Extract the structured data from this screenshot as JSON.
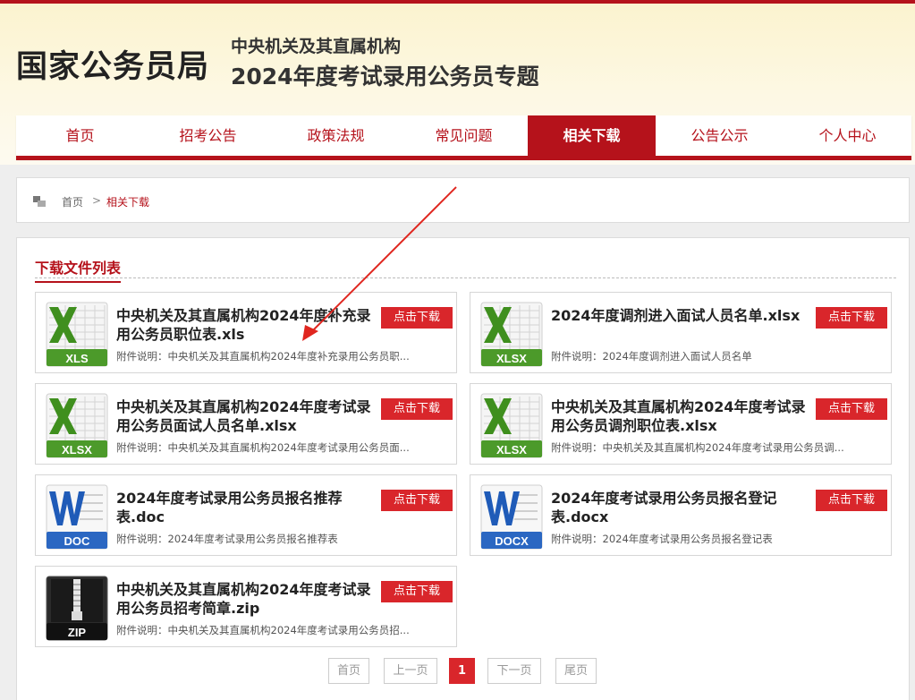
{
  "header": {
    "site_name": "国家公务员局",
    "subtitle1": "中央机关及其直属机构",
    "subtitle2": "2024年度考试录用公务员专题"
  },
  "nav": {
    "items": [
      {
        "label": "首页",
        "active": false
      },
      {
        "label": "招考公告",
        "active": false
      },
      {
        "label": "政策法规",
        "active": false
      },
      {
        "label": "常见问题",
        "active": false
      },
      {
        "label": "相关下载",
        "active": true
      },
      {
        "label": "公告公示",
        "active": false
      },
      {
        "label": "个人中心",
        "active": false
      }
    ]
  },
  "breadcrumb": {
    "home": "首页",
    "separator": ">",
    "current": "相关下载"
  },
  "section": {
    "title": "下载文件列表"
  },
  "files": [
    {
      "type": "xls",
      "ext_label": "XLS",
      "title": "中央机关及其直属机构2024年度补充录用公务员职位表.xls",
      "desc": "附件说明：中央机关及其直属机构2024年度补充录用公务员职...",
      "button": "点击下载"
    },
    {
      "type": "xls",
      "ext_label": "XLSX",
      "title": "2024年度调剂进入面试人员名单.xlsx",
      "desc": "附件说明：2024年度调剂进入面试人员名单",
      "button": "点击下载"
    },
    {
      "type": "xls",
      "ext_label": "XLSX",
      "title": "中央机关及其直属机构2024年度考试录用公务员面试人员名单.xlsx",
      "desc": "附件说明：中央机关及其直属机构2024年度考试录用公务员面...",
      "button": "点击下载"
    },
    {
      "type": "xls",
      "ext_label": "XLSX",
      "title": "中央机关及其直属机构2024年度考试录用公务员调剂职位表.xlsx",
      "desc": "附件说明：中央机关及其直属机构2024年度考试录用公务员调...",
      "button": "点击下载"
    },
    {
      "type": "doc",
      "ext_label": "DOC",
      "title": "2024年度考试录用公务员报名推荐表.doc",
      "desc": "附件说明：2024年度考试录用公务员报名推荐表",
      "button": "点击下载"
    },
    {
      "type": "doc",
      "ext_label": "DOCX",
      "title": "2024年度考试录用公务员报名登记表.docx",
      "desc": "附件说明：2024年度考试录用公务员报名登记表",
      "button": "点击下载"
    },
    {
      "type": "zip",
      "ext_label": "ZIP",
      "title": "中央机关及其直属机构2024年度考试录用公务员招考简章.zip",
      "desc": "附件说明：中央机关及其直属机构2024年度考试录用公务员招...",
      "button": "点击下载"
    }
  ],
  "pagination": {
    "first": "首页",
    "prev": "上一页",
    "current": "1",
    "next": "下一页",
    "last": "尾页"
  },
  "colors": {
    "brand_red": "#b5121b",
    "button_red": "#d9262b",
    "excel_green": "#4c9a2a",
    "word_blue": "#2b67c2"
  }
}
